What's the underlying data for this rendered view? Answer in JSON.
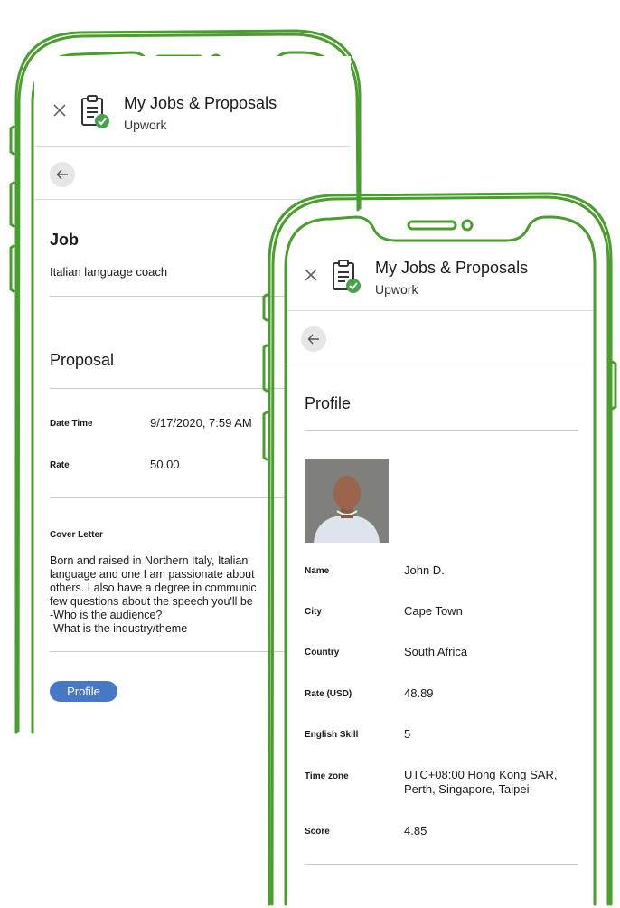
{
  "app": {
    "title": "My Jobs & Proposals",
    "subtitle": "Upwork"
  },
  "job_screen": {
    "job_heading": "Job",
    "job_title": "Italian language coach",
    "proposal_heading": "Proposal",
    "fields": [
      {
        "label": "Date Time",
        "value": "9/17/2020, 7:59 AM"
      },
      {
        "label": "Rate",
        "value": "50.00"
      }
    ],
    "cover_letter_label": "Cover Letter",
    "cover_letter_lines": [
      "Born and raised in Northern Italy, Italian",
      "language and one I am passionate about",
      "others. I also have a degree in communic",
      "few questions about the speech you'll be",
      "-Who is the audience?",
      "-What is the industry/theme"
    ],
    "profile_button": "Profile"
  },
  "profile_screen": {
    "heading": "Profile",
    "fields": [
      {
        "label": "Name",
        "value": "John D."
      },
      {
        "label": "City",
        "value": "Cape Town"
      },
      {
        "label": "Country",
        "value": "South Africa"
      },
      {
        "label": "Rate (USD)",
        "value": "48.89"
      },
      {
        "label": "English Skill",
        "value": "5"
      },
      {
        "label": "Time zone",
        "value": "UTC+08:00 Hong Kong SAR,",
        "value2": "Perth, Singapore, Taipei"
      },
      {
        "label": "Score",
        "value": "4.85"
      }
    ]
  },
  "colors": {
    "outline_green": "#4a9e2e",
    "badge_green": "#47a34b",
    "profile_button": "#4678c8"
  },
  "icons": [
    "close-icon",
    "clipboard-check-icon",
    "back-arrow-icon",
    "phone-speaker",
    "phone-camera",
    "profile-photo"
  ]
}
